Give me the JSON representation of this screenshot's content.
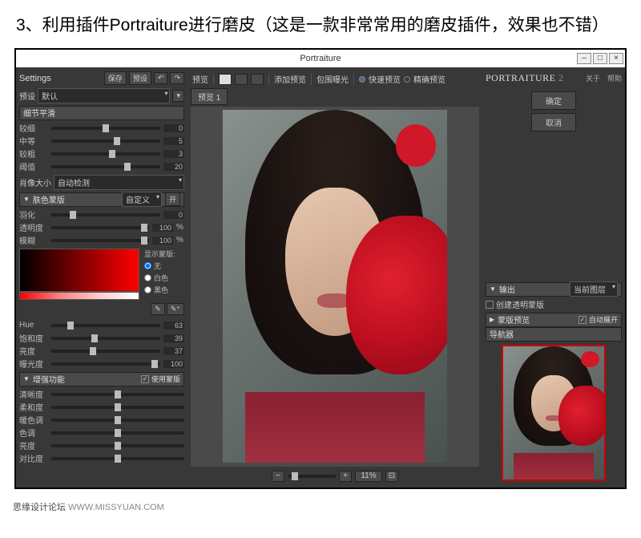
{
  "header_text": "3、利用插件Portraiture进行磨皮（这是一款非常常用的磨皮插件，效果也不错）",
  "window_title": "Portraiture",
  "settings": {
    "label": "Settings",
    "save": "保存",
    "preset": "预设",
    "preset_label": "预设",
    "default": "默认"
  },
  "detail": {
    "title": "细节平滑",
    "rows": [
      {
        "label": "较细",
        "value": "0",
        "pos": 50
      },
      {
        "label": "中等",
        "value": "5",
        "pos": 60
      },
      {
        "label": "较粗",
        "value": "3",
        "pos": 56
      },
      {
        "label": "阈值",
        "value": "20",
        "pos": 70
      }
    ]
  },
  "portrait_size": {
    "label": "肖像大小",
    "value": "自动检测"
  },
  "skin_mask": {
    "title": "肤色蒙版",
    "custom": "自定义",
    "open": "开",
    "show_mask": "显示蒙版:",
    "params": [
      {
        "label": "羽化",
        "value": "0",
        "pos": 20,
        "suffix": ""
      },
      {
        "label": "透明度",
        "value": "100",
        "pos": 95,
        "suffix": "%"
      },
      {
        "label": "模糊",
        "value": "100",
        "pos": 95,
        "suffix": "%"
      }
    ],
    "radios": [
      "无",
      "白色",
      "黑色"
    ],
    "hsl": [
      {
        "label": "Hue",
        "value": "63",
        "pos": 18
      },
      {
        "label": "饱和度",
        "value": "39",
        "pos": 40
      },
      {
        "label": "亮度",
        "value": "37",
        "pos": 38
      },
      {
        "label": "曝光度",
        "value": "100",
        "pos": 95
      }
    ]
  },
  "enhance": {
    "title": "增强功能",
    "use_mask": "使用蒙版",
    "rows": [
      {
        "label": "清晰度",
        "pos": 50
      },
      {
        "label": "柔和度",
        "pos": 50
      },
      {
        "label": "暖色调",
        "pos": 50
      },
      {
        "label": "色调",
        "pos": 50
      },
      {
        "label": "亮度",
        "pos": 50
      },
      {
        "label": "对比度",
        "pos": 50
      }
    ]
  },
  "preview": {
    "label": "预览",
    "tab": "预览 1",
    "add": "添加预览",
    "exposure": "包围曝光",
    "fast": "快速预览",
    "precise": "精确预览"
  },
  "zoom": {
    "value": "11%"
  },
  "branding": {
    "name": "PORTRAITURE",
    "version": "2",
    "about": "关于",
    "help": "帮助"
  },
  "actions": {
    "ok": "确定",
    "cancel": "取消"
  },
  "output": {
    "title": "输出",
    "layer": "当前图层",
    "transparency": "创建透明蒙版"
  },
  "mask_preview": {
    "title": "蒙版预览",
    "auto": "自动展开"
  },
  "navigator": {
    "title": "导航器"
  },
  "footer": {
    "cn": "思缘设计论坛",
    "url": "WWW.MISSYUAN.COM"
  }
}
